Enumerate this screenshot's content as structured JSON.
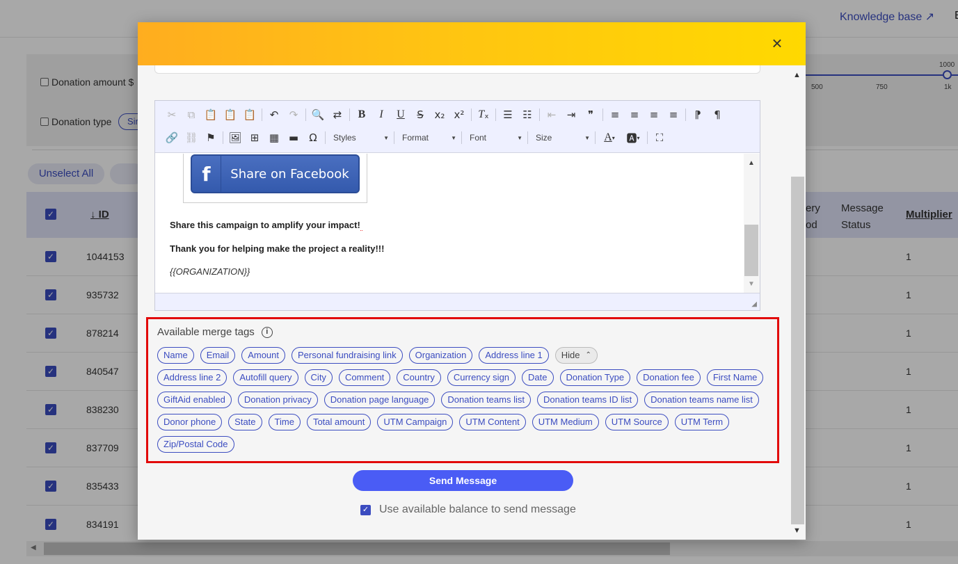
{
  "background": {
    "knowledge_base": "Knowledge base ↗",
    "tab_partial": "E",
    "filters": {
      "donation_amount": "Donation amount $",
      "donation_type": "Donation type",
      "donation_type_value": "Sir",
      "slider_labels": [
        "500",
        "750",
        "1k"
      ],
      "slider_max": "1000"
    },
    "unselect_all": "Unselect All",
    "table": {
      "col_id": "↓ ID",
      "col_delivery_line1": "ery",
      "col_delivery_line2": "od",
      "col_message_status_line1": "Message",
      "col_message_status_line2": "Status",
      "col_multiplier": "Multiplier",
      "rows": [
        {
          "id": "1044153",
          "multiplier": "1"
        },
        {
          "id": "935732",
          "multiplier": "1"
        },
        {
          "id": "878214",
          "multiplier": "1"
        },
        {
          "id": "840547",
          "multiplier": "1"
        },
        {
          "id": "838230",
          "multiplier": "1"
        },
        {
          "id": "837709",
          "multiplier": "1"
        },
        {
          "id": "835433",
          "multiplier": "1"
        },
        {
          "id": "834191",
          "multiplier": "1"
        }
      ]
    }
  },
  "modal": {
    "close": "×",
    "editor": {
      "toolbar_dropdowns": {
        "styles": "Styles",
        "format": "Format",
        "font": "Font",
        "size": "Size"
      },
      "facebook_button": "Share on Facebook",
      "line1": "Share this campaign to amplify your impact!",
      "line2": "Thank you for helping make the project a reality!!!",
      "line3": "{{ORGANIZATION}}"
    },
    "merge_tags": {
      "title": "Available merge tags",
      "info_icon": "i",
      "hide_label": "Hide",
      "rows": [
        [
          "Name",
          "Email",
          "Amount",
          "Personal fundraising link",
          "Organization",
          "Address line 1"
        ],
        [
          "Address line 2",
          "Autofill query",
          "City",
          "Comment",
          "Country",
          "Currency sign",
          "Date",
          "Donation Type",
          "Donation fee",
          "First Name"
        ],
        [
          "GiftAid enabled",
          "Donation privacy",
          "Donation page language",
          "Donation teams list",
          "Donation teams ID list",
          "Donation teams name list"
        ],
        [
          "Donor phone",
          "State",
          "Time",
          "Total amount",
          "UTM Campaign",
          "UTM Content",
          "UTM Medium",
          "UTM Source",
          "UTM Term"
        ],
        [
          "Zip/Postal Code"
        ]
      ]
    },
    "send_button": "Send Message",
    "use_balance_label": "Use available balance to send message",
    "use_balance_checked": true
  },
  "colors": {
    "accent": "#3b4cc0",
    "send_button": "#4a5cf5",
    "highlight_border": "#e20a0a",
    "header_gradient_start": "#ffad1f",
    "header_gradient_end": "#ffd900"
  }
}
